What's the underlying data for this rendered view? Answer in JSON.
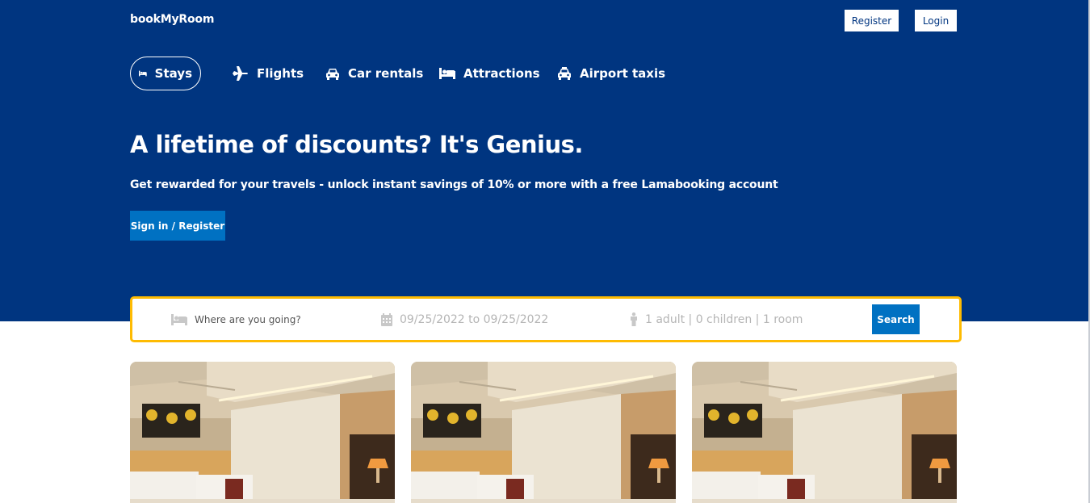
{
  "header": {
    "logo": "bookMyRoom",
    "register_label": "Register",
    "login_label": "Login"
  },
  "nav": {
    "items": [
      {
        "label": "Stays",
        "icon": "bed-icon",
        "active": true
      },
      {
        "label": "Flights",
        "icon": "plane-icon",
        "active": false
      },
      {
        "label": "Car rentals",
        "icon": "car-icon",
        "active": false
      },
      {
        "label": "Attractions",
        "icon": "bed-icon",
        "active": false
      },
      {
        "label": "Airport taxis",
        "icon": "taxi-icon",
        "active": false
      }
    ]
  },
  "hero": {
    "title": "A lifetime of discounts? It's Genius.",
    "description": "Get rewarded for your travels - unlock instant savings of 10% or more with a free Lamabooking account",
    "cta_label": "Sign in / Register"
  },
  "search": {
    "destination_placeholder": "Where are you going?",
    "date_range": "09/25/2022 to 09/25/2022",
    "guests": "1 adult | 0 children | 1 room",
    "button_label": "Search"
  },
  "colors": {
    "brand_blue": "#003580",
    "accent_blue": "#0071c2",
    "search_border": "#febb02"
  },
  "cards": [
    {
      "image": "hotel-room-photo"
    },
    {
      "image": "hotel-room-photo"
    },
    {
      "image": "hotel-room-photo"
    }
  ]
}
